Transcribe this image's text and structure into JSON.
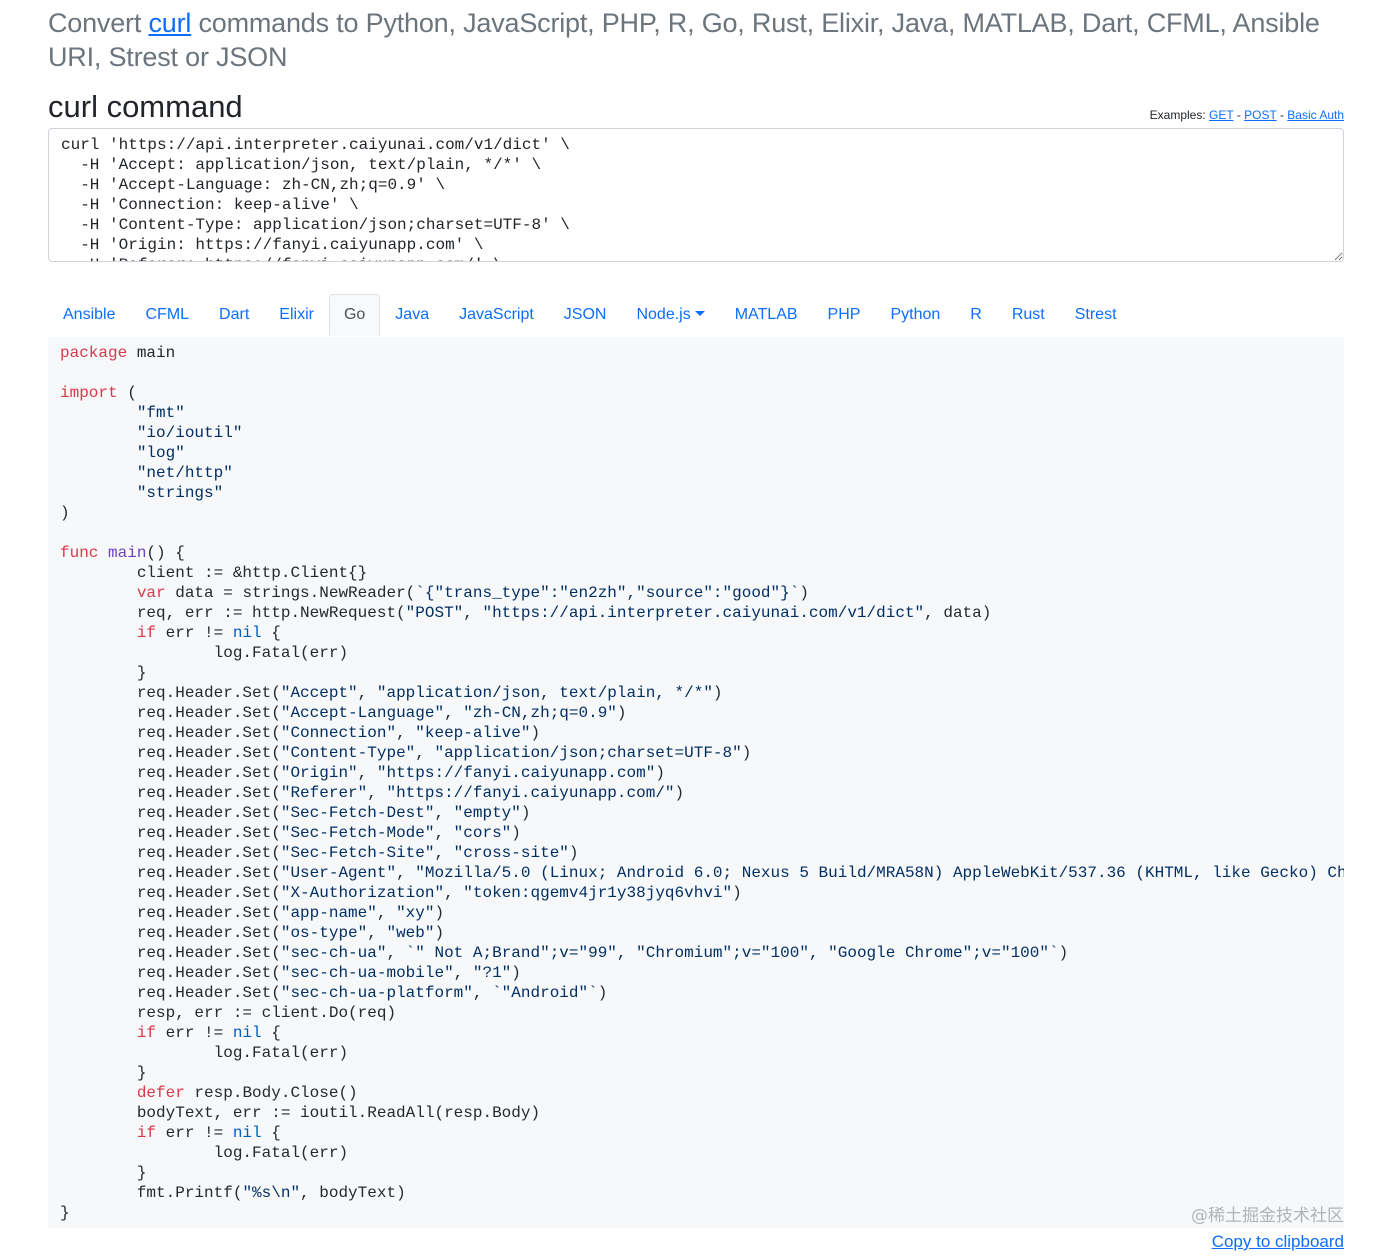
{
  "header": {
    "prefix": "Convert ",
    "link": "curl",
    "suffix": " commands to Python, JavaScript, PHP, R, Go, Rust, Elixir, Java, MATLAB, Dart, CFML, Ansible URI, Strest or JSON"
  },
  "command": {
    "title": "curl command",
    "examples_label": "Examples:",
    "examples": [
      "GET",
      "POST",
      "Basic Auth"
    ],
    "separator": " - ",
    "value": "curl 'https://api.interpreter.caiyunai.com/v1/dict' \\\n  -H 'Accept: application/json, text/plain, */*' \\\n  -H 'Accept-Language: zh-CN,zh;q=0.9' \\\n  -H 'Connection: keep-alive' \\\n  -H 'Content-Type: application/json;charset=UTF-8' \\\n  -H 'Origin: https://fanyi.caiyunapp.com' \\\n  -H 'Referer: https://fanyi.caiyunapp.com/' \\"
  },
  "tabs": [
    {
      "label": "Ansible"
    },
    {
      "label": "CFML"
    },
    {
      "label": "Dart"
    },
    {
      "label": "Elixir"
    },
    {
      "label": "Go",
      "active": true
    },
    {
      "label": "Java"
    },
    {
      "label": "JavaScript"
    },
    {
      "label": "JSON"
    },
    {
      "label": "Node.js",
      "dropdown": true
    },
    {
      "label": "MATLAB"
    },
    {
      "label": "PHP"
    },
    {
      "label": "Python"
    },
    {
      "label": "R"
    },
    {
      "label": "Rust"
    },
    {
      "label": "Strest"
    }
  ],
  "code": {
    "language": "Go",
    "keywords": [
      "package",
      "import",
      "func",
      "var",
      "if",
      "defer"
    ],
    "literals": [
      "nil"
    ],
    "functions": [
      "main"
    ],
    "lines": [
      "package main",
      "",
      "import (",
      "\t\"fmt\"",
      "\t\"io/ioutil\"",
      "\t\"log\"",
      "\t\"net/http\"",
      "\t\"strings\"",
      ")",
      "",
      "func main() {",
      "\tclient := &http.Client{}",
      "\tvar data = strings.NewReader(`{\"trans_type\":\"en2zh\",\"source\":\"good\"}`)",
      "\treq, err := http.NewRequest(\"POST\", \"https://api.interpreter.caiyunai.com/v1/dict\", data)",
      "\tif err != nil {",
      "\t\tlog.Fatal(err)",
      "\t}",
      "\treq.Header.Set(\"Accept\", \"application/json, text/plain, */*\")",
      "\treq.Header.Set(\"Accept-Language\", \"zh-CN,zh;q=0.9\")",
      "\treq.Header.Set(\"Connection\", \"keep-alive\")",
      "\treq.Header.Set(\"Content-Type\", \"application/json;charset=UTF-8\")",
      "\treq.Header.Set(\"Origin\", \"https://fanyi.caiyunapp.com\")",
      "\treq.Header.Set(\"Referer\", \"https://fanyi.caiyunapp.com/\")",
      "\treq.Header.Set(\"Sec-Fetch-Dest\", \"empty\")",
      "\treq.Header.Set(\"Sec-Fetch-Mode\", \"cors\")",
      "\treq.Header.Set(\"Sec-Fetch-Site\", \"cross-site\")",
      "\treq.Header.Set(\"User-Agent\", \"Mozilla/5.0 (Linux; Android 6.0; Nexus 5 Build/MRA58N) AppleWebKit/537.36 (KHTML, like Gecko) Ch",
      "\treq.Header.Set(\"X-Authorization\", \"token:qgemv4jr1y38jyq6vhvi\")",
      "\treq.Header.Set(\"app-name\", \"xy\")",
      "\treq.Header.Set(\"os-type\", \"web\")",
      "\treq.Header.Set(\"sec-ch-ua\", `\" Not A;Brand\";v=\"99\", \"Chromium\";v=\"100\", \"Google Chrome\";v=\"100\"`)",
      "\treq.Header.Set(\"sec-ch-ua-mobile\", \"?1\")",
      "\treq.Header.Set(\"sec-ch-ua-platform\", `\"Android\"`)",
      "\tresp, err := client.Do(req)",
      "\tif err != nil {",
      "\t\tlog.Fatal(err)",
      "\t}",
      "\tdefer resp.Body.Close()",
      "\tbodyText, err := ioutil.ReadAll(resp.Body)",
      "\tif err != nil {",
      "\t\tlog.Fatal(err)",
      "\t}",
      "\tfmt.Printf(\"%s\\n\", bodyText)",
      "}"
    ]
  },
  "watermark": "@稀土掘金技术社区",
  "copy_label": "Copy to clipboard",
  "colors": {
    "link": "#0d6efd",
    "muted_heading": "#6c757d",
    "code_bg": "#f6f8fa",
    "keyword": "#d73a49",
    "string": "#032f62",
    "literal": "#005cc5",
    "function": "#6f42c1"
  }
}
